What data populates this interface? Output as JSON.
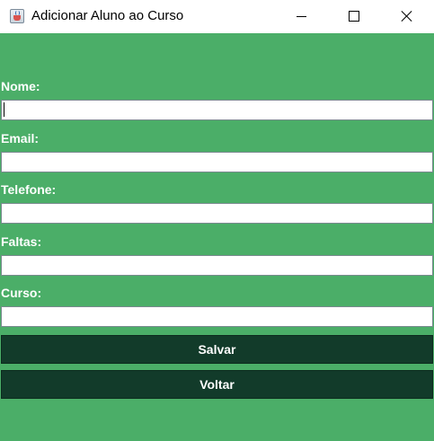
{
  "window": {
    "title": "Adicionar Aluno ao Curso",
    "icon": "java-cup-icon",
    "controls": {
      "minimize": "minimize-icon",
      "maximize": "maximize-icon",
      "close": "close-icon"
    }
  },
  "form": {
    "nome_label": "Nome:",
    "nome_value": "",
    "email_label": "Email:",
    "email_value": "",
    "telefone_label": "Telefone:",
    "telefone_value": "",
    "faltas_label": "Faltas:",
    "faltas_value": "",
    "curso_label": "Curso:",
    "curso_value": ""
  },
  "actions": {
    "save_label": "Salvar",
    "back_label": "Voltar"
  },
  "colors": {
    "panel_background": "#4bae68",
    "button_background": "#123b2a",
    "label_text": "#ffffff"
  }
}
